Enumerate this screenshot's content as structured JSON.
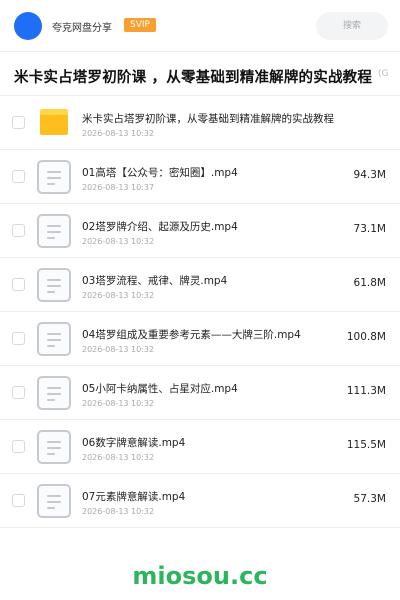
{
  "header": {
    "share_name": "夸克网盘分享",
    "badge": "SVIP",
    "search_label": "搜索"
  },
  "title": {
    "text": "米卡实占塔罗初阶课 ，从零基础到精准解牌的实战教程",
    "suffix": "(G"
  },
  "files": [
    {
      "type": "folder",
      "name": "米卡实占塔罗初阶课，从零基础到精准解牌的实战教程",
      "date": "2026-08-13 10:32",
      "size": ""
    },
    {
      "type": "file",
      "name": "01高塔【公众号：密知圈】.mp4",
      "date": "2026-08-13 10:37",
      "size": "94.3M"
    },
    {
      "type": "file",
      "name": "02塔罗牌介绍、起源及历史.mp4",
      "date": "2026-08-13 10:32",
      "size": "73.1M"
    },
    {
      "type": "file",
      "name": "03塔罗流程、戒律、牌灵.mp4",
      "date": "2026-08-13 10:32",
      "size": "61.8M"
    },
    {
      "type": "file",
      "name": "04塔罗组成及重要参考元素——大牌三阶.mp4",
      "date": "2026-08-13 10:32",
      "size": "100.8M"
    },
    {
      "type": "file",
      "name": "05小阿卡纳属性、占星对应.mp4",
      "date": "2026-08-13 10:32",
      "size": "111.3M"
    },
    {
      "type": "file",
      "name": "06数字牌意解读.mp4",
      "date": "2026-08-13 10:32",
      "size": "115.5M"
    },
    {
      "type": "file",
      "name": "07元素牌意解读.mp4",
      "date": "2026-08-13 10:32",
      "size": "57.3M"
    }
  ],
  "watermark": "miosou.cc",
  "colors": {
    "avatar": "#1e6ff5",
    "badge": "#f5a031",
    "folder": "#fcbf1e",
    "watermark": "#2db55d"
  }
}
